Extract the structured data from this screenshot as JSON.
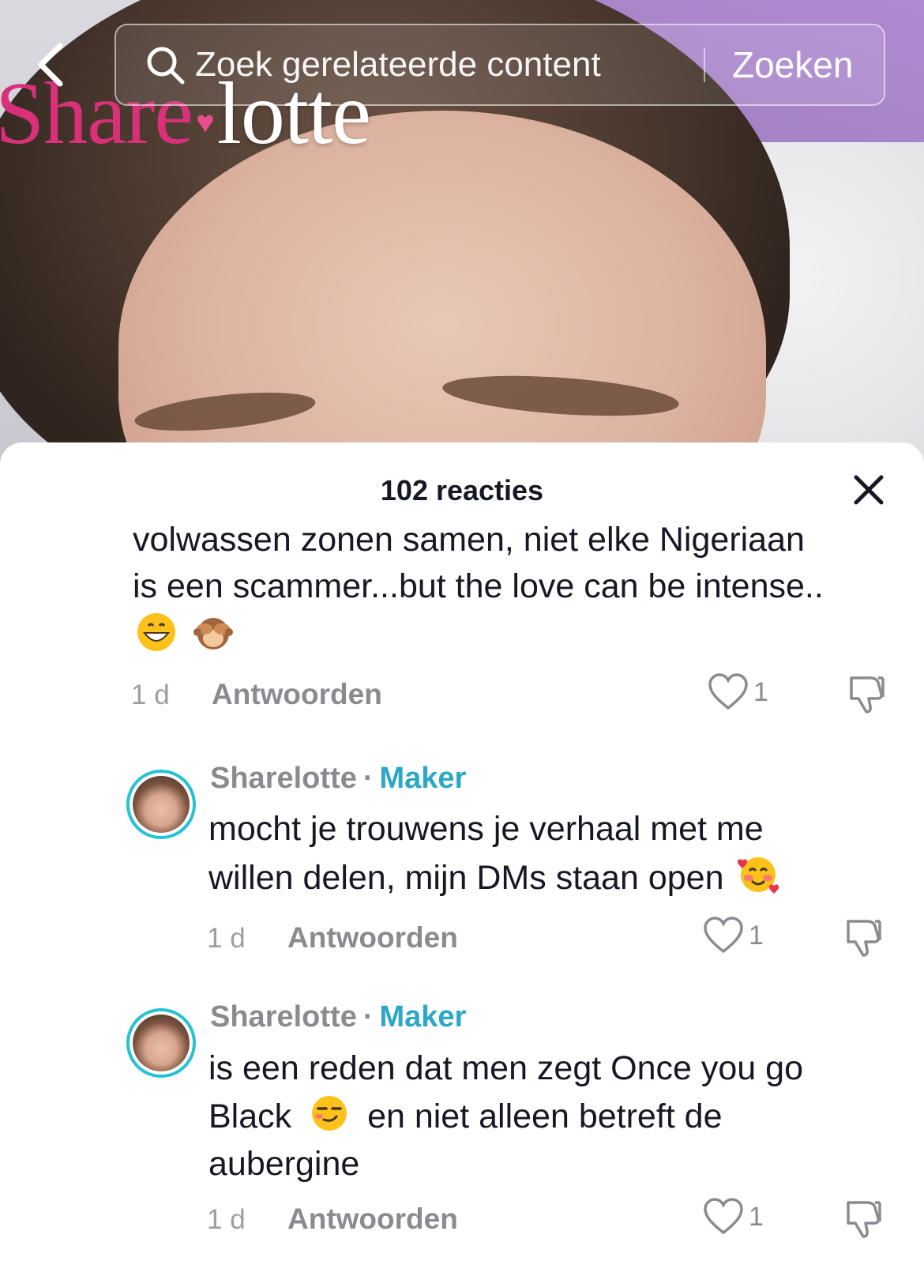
{
  "search": {
    "placeholder": "Zoek gerelateerde content",
    "button_label": "Zoeken"
  },
  "video": {
    "watermark_part1": "Share",
    "watermark_part2": "lotte"
  },
  "sheet": {
    "title": "102 reacties",
    "close_icon": "close-icon"
  },
  "comments": [
    {
      "text_line1": "volwassen zonen samen, niet elke Nigeriaan",
      "text_line2": "is een scammer...but the love can be intense..",
      "emojis": [
        "grinning-face-emoji",
        "see-no-evil-monkey-emoji"
      ],
      "time": "1 d",
      "reply_label": "Antwoorden",
      "likes": "1"
    },
    {
      "username": "Sharelotte",
      "separator": "·",
      "badge": "Maker",
      "text_line1": "mocht je trouwens je verhaal met me",
      "text_line2": "willen delen, mijn DMs staan open",
      "emojis": [
        "smiling-face-with-hearts-emoji"
      ],
      "time": "1 d",
      "reply_label": "Antwoorden",
      "likes": "1"
    },
    {
      "username": "Sharelotte",
      "separator": "·",
      "badge": "Maker",
      "text_line1": "is een reden dat men zegt Once you go",
      "text_line2a": "Black",
      "text_line2b": "en niet alleen betreft de",
      "text_line3": "aubergine",
      "emojis": [
        "smirking-face-emoji"
      ],
      "time": "1 d",
      "reply_label": "Antwoorden",
      "likes": "1"
    }
  ],
  "colors": {
    "maker_badge": "#2aa8c6",
    "avatar_ring": "#25c2d6",
    "text": "#161823",
    "muted": "#8a8b91"
  }
}
